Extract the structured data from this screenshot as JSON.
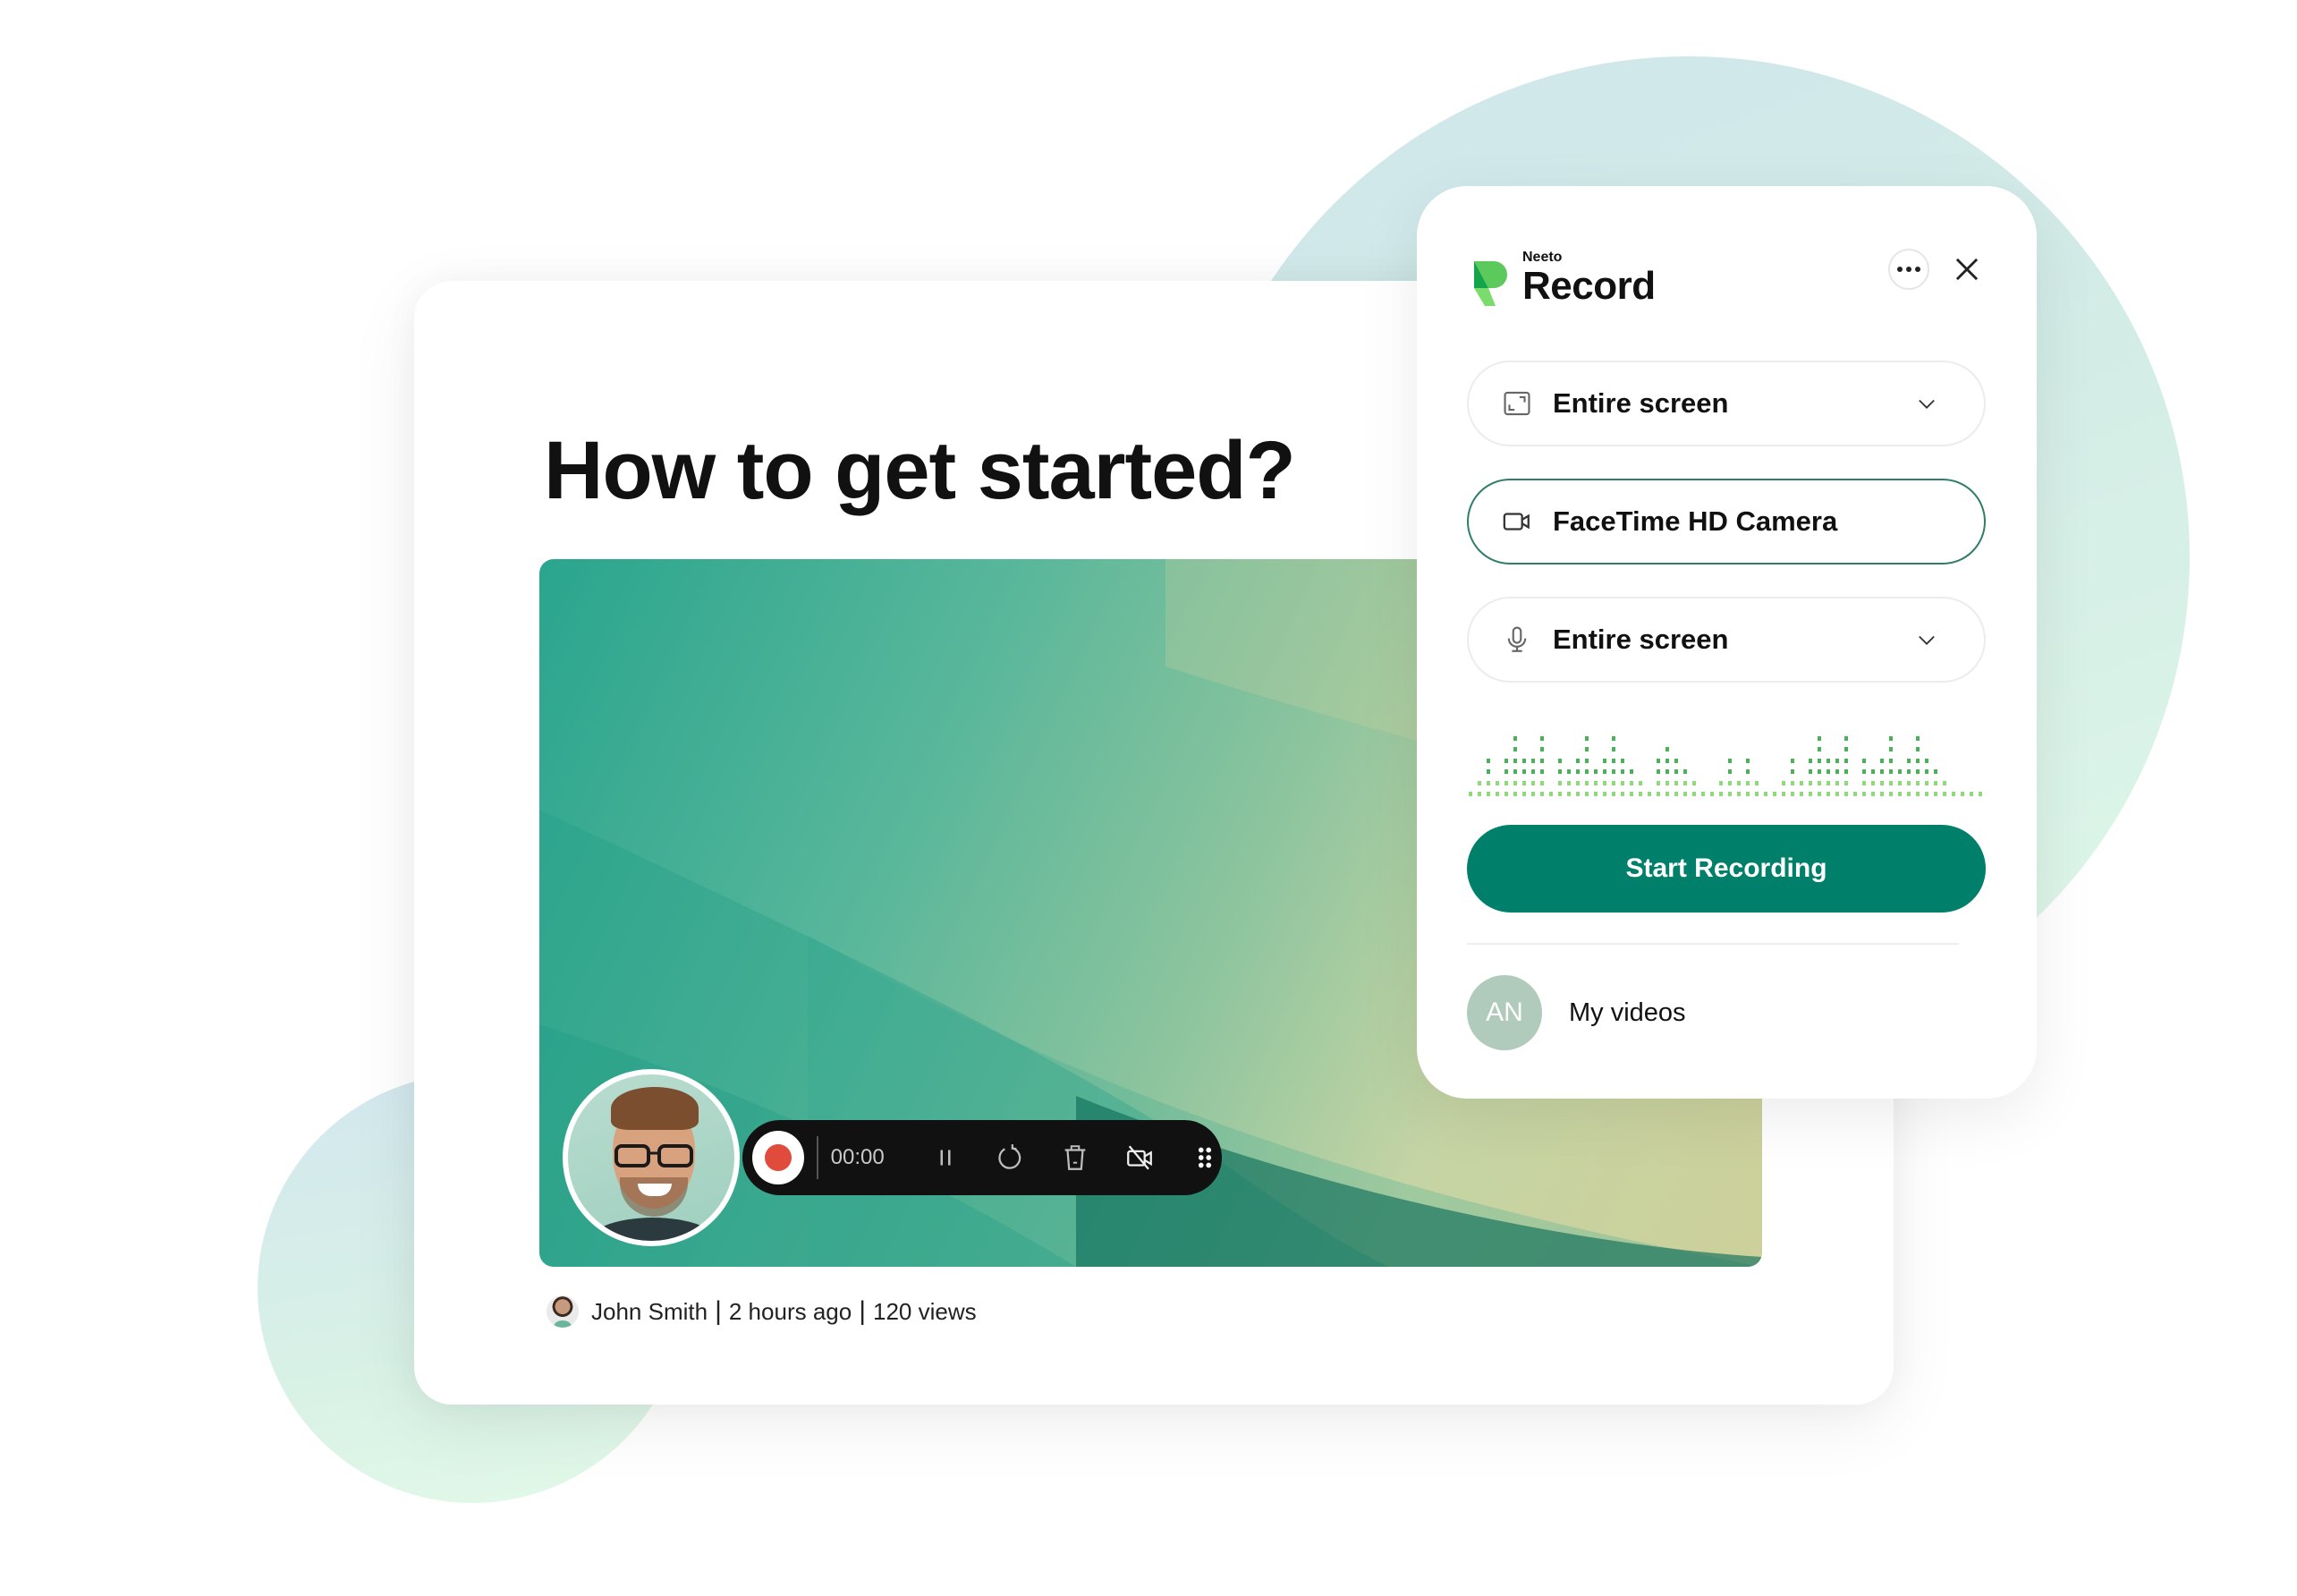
{
  "background": {
    "accent": "#00806a"
  },
  "article": {
    "title": "How to get started?",
    "author": "John Smith",
    "posted": "2 hours ago",
    "views": "120 views",
    "separator": "|"
  },
  "recorder_bar": {
    "timer": "00:00",
    "record_color": "#e04b3c",
    "icons": [
      "record-icon",
      "pause-icon",
      "restart-icon",
      "trash-icon",
      "camera-off-icon",
      "drag-handle-icon"
    ]
  },
  "panel": {
    "brand_small": "Neeto",
    "brand_large": "Record",
    "screen_source": {
      "label": "Entire screen",
      "icon": "screen-icon"
    },
    "camera_source": {
      "label": "FaceTime HD Camera",
      "icon": "video-camera-icon"
    },
    "mic_source": {
      "label": "Entire screen",
      "icon": "microphone-icon"
    },
    "audio_level": {
      "max_rows": 6,
      "column_levels": [
        1,
        2,
        4,
        2,
        4,
        6,
        4,
        4,
        6,
        1,
        4,
        3,
        4,
        6,
        3,
        4,
        6,
        4,
        3,
        2,
        1,
        4,
        5,
        4,
        3,
        2,
        1,
        1,
        2,
        4,
        2,
        4,
        2,
        1,
        1,
        2,
        4,
        2,
        4,
        6,
        4,
        4,
        6,
        1,
        4,
        3,
        4,
        6,
        3,
        4,
        6,
        4,
        3,
        2,
        1,
        1,
        1,
        1
      ]
    },
    "start_button": "Start Recording",
    "user_initials": "AN",
    "my_videos": "My videos",
    "colors": {
      "primary": "#00806a",
      "meter_dark": "#4caf5a",
      "meter_light": "#8fd97a",
      "avatar": "#b0cbbb",
      "active_border": "#2f7d6a"
    }
  }
}
